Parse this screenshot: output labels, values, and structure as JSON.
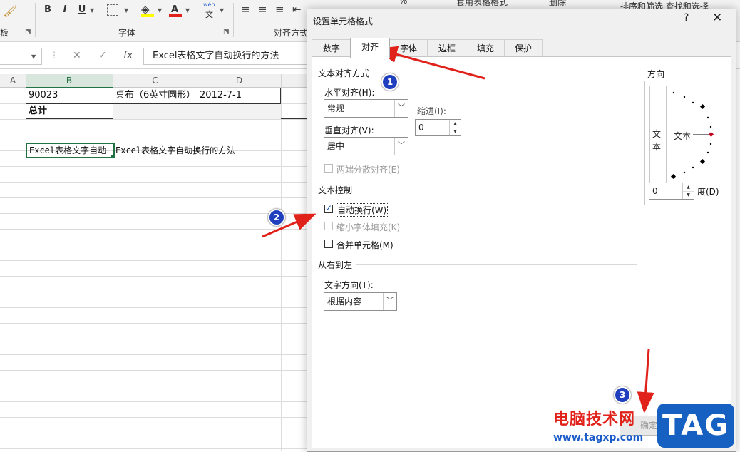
{
  "ribbon": {
    "left_group_label": "板",
    "font_group_label": "字体",
    "align_group_label": "对齐方式",
    "bold": "B",
    "italic": "I",
    "underline": "U",
    "font_color": "A",
    "pinyin_top": "wén",
    "pinyin_bottom": "文",
    "right_item_1": "套用表格格式",
    "right_item_2": "删除",
    "right_item_3": "排序和筛选 查找和选择",
    "percent": "%"
  },
  "formula_bar": {
    "cancel": "✕",
    "enter": "✓",
    "fx": "fx",
    "content": "Excel表格文字自动换行的方法"
  },
  "sheet": {
    "columns": [
      "A",
      "B",
      "C",
      "D"
    ],
    "rows": [
      {
        "b": "90023",
        "c": "桌布（6英寸圆形）",
        "d": "2012-7-1"
      },
      {
        "b": "总计",
        "c": "",
        "d": ""
      }
    ],
    "b5": "Excel表格文字自动",
    "c5": "Excel表格文字自动换行的方法"
  },
  "dialog": {
    "title": "设置单元格格式",
    "help": "?",
    "close": "✕",
    "tabs": [
      "数字",
      "对齐",
      "字体",
      "边框",
      "填充",
      "保护"
    ],
    "active_tab": "对齐",
    "text_align_section": "文本对齐方式",
    "horizontal_label": "水平对齐(H):",
    "horizontal_value": "常规",
    "indent_label": "缩进(I):",
    "indent_value": "0",
    "vertical_label": "垂直对齐(V):",
    "vertical_value": "居中",
    "distributed_label": "两端分散对齐(E)",
    "text_control_section": "文本控制",
    "wrap_text_label": "自动换行(W)",
    "wrap_text_checked": true,
    "shrink_label": "缩小字体填充(K)",
    "merge_label": "合并单元格(M)",
    "rtl_section": "从右到左",
    "direction_label": "文字方向(T):",
    "direction_value": "根据内容",
    "orientation_section": "方向",
    "orientation_vertical_text": "文本",
    "orientation_horizontal_text": "文本",
    "degrees_value": "0",
    "degrees_label": "度(D)",
    "ok_label": "确定"
  },
  "annotations": {
    "badge_1": "1",
    "badge_2": "2",
    "badge_3": "3",
    "arrow_color": "#e0221a",
    "badge_color": "#1f3fbf"
  },
  "watermark": {
    "site_name": "电脑技术网",
    "url": "www.tagxp.com",
    "tag": "TAG"
  }
}
